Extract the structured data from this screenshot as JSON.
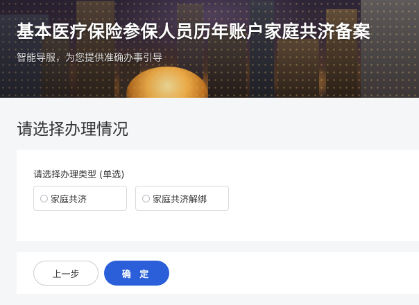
{
  "banner": {
    "title": "基本医疗保险参保人员历年账户家庭共济备案",
    "subtitle": "智能导服，为您提供准确办事引导"
  },
  "main": {
    "section_title": "请选择办理情况",
    "question_label": "请选择办理类型 (单选)",
    "options": [
      {
        "label": "家庭共济",
        "selected": false
      },
      {
        "label": "家庭共济解绑",
        "selected": false
      }
    ]
  },
  "footer": {
    "prev_label": "上一步",
    "confirm_label": "确 定"
  },
  "colors": {
    "primary": "#2b5fd9",
    "page_bg": "#f5f6f8",
    "card_bg": "#ffffff",
    "border": "#d7d9de"
  }
}
